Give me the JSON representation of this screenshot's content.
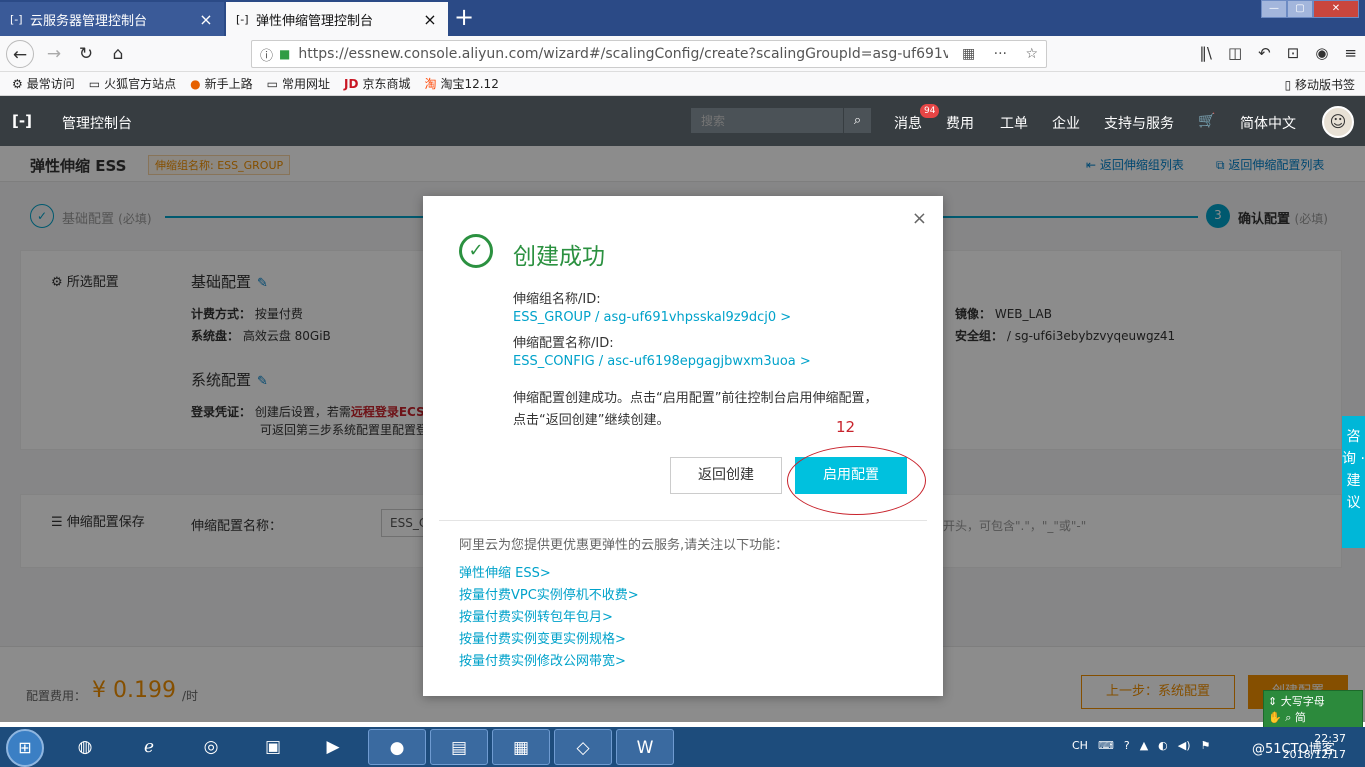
{
  "browser": {
    "tabs": [
      {
        "label": "云服务器管理控制台",
        "favicon": "[-]"
      },
      {
        "label": "弹性伸缩管理控制台",
        "favicon": "[-]"
      }
    ],
    "url": "https://essnew.console.aliyun.com/wizard#/scalingConfig/create?scalingGroupId=asg-uf691vh",
    "bookmarks": [
      {
        "icon": "gear-icon",
        "label": "最常访问"
      },
      {
        "icon": "folder-icon",
        "label": "火狐官方站点"
      },
      {
        "icon": "firefox-icon",
        "label": "新手上路"
      },
      {
        "icon": "folder-icon",
        "label": "常用网址"
      },
      {
        "icon": "jd-icon",
        "label": "京东商城"
      },
      {
        "icon": "taobao-icon",
        "label": "淘宝12.12"
      }
    ],
    "mobile_bookmarks": "移动版书签"
  },
  "console": {
    "title": "管理控制台",
    "search_placeholder": "搜索",
    "nav": [
      "消息",
      "费用",
      "工单",
      "企业",
      "支持与服务",
      "简体中文"
    ],
    "message_badge": "94"
  },
  "page": {
    "title": "弹性伸缩 ESS",
    "group_tag": "伸缩组名称: ESS_GROUP",
    "link_groups": "返回伸缩组列表",
    "link_configs": "返回伸缩配置列表",
    "steps": [
      {
        "index": "✓",
        "label": "基础配置",
        "note": "(必填)"
      },
      {
        "index": "3",
        "label": "确认配置",
        "note": "(必填)"
      }
    ],
    "selected_config": "所选配置",
    "basic_config": "基础配置",
    "billing_label": "计费方式：",
    "billing_value": "按量付费",
    "disk_label": "系统盘：",
    "disk_value": "高效云盘 80GiB",
    "image_label": "镜像：",
    "image_value": "WEB_LAB",
    "secgroup_label": "安全组：",
    "secgroup_value": "/ sg-uf6i3ebybzvyqeuwgz41",
    "system_config": "系统配置",
    "login_label": "登录凭证：",
    "login_text_1": "创建后设置，若需",
    "login_text_highlight": "远程登录ECS",
    "login_text_2": "可返回第三步系统配置里配置登",
    "save_section": "伸缩配置保存",
    "config_name_label": "伸缩配置名称：",
    "config_name_value": "ESS_CONF",
    "name_hint": "开头，可包含\".\"，\"_\"或\"-\"",
    "side_float": "咨 询 · 建 议",
    "cost_label": "配置费用：",
    "cost_value": "¥ 0.199",
    "cost_unit": "/时",
    "prev_button": "上一步：系统配置",
    "next_button": "创建配置"
  },
  "modal": {
    "title": "创建成功",
    "group_label": "伸缩组名称/ID:",
    "group_link": "ESS_GROUP / asg-uf691vhpsskal9z9dcj0 >",
    "config_label": "伸缩配置名称/ID:",
    "config_link": "ESS_CONFIG / asc-uf6198epgagjbwxm3uoa >",
    "desc_line1": "伸缩配置创建成功。点击“启用配置”前往控制台启用伸缩配置，",
    "desc_line2": "点击“返回创建”继续创建。",
    "back_button": "返回创建",
    "enable_button": "启用配置",
    "annotation_number": "12",
    "promo_title": "阿里云为您提供更优惠更弹性的云服务,请关注以下功能：",
    "promo_links": [
      "弹性伸缩 ESS>",
      "按量付费VPC实例停机不收费>",
      "按量付费实例转包年包月>",
      "按量付费实例变更实例规格>",
      "按量付费实例修改公网带宽>"
    ],
    "accent_color": "#00c1de",
    "success_color": "#2b9140"
  },
  "taskbar": {
    "ime_status": "大写字母",
    "ime_mode": "简",
    "tray_lang": "CH",
    "clock_time": "22:37",
    "clock_date": "2018/12/17",
    "watermark": "@51CTO博客"
  }
}
